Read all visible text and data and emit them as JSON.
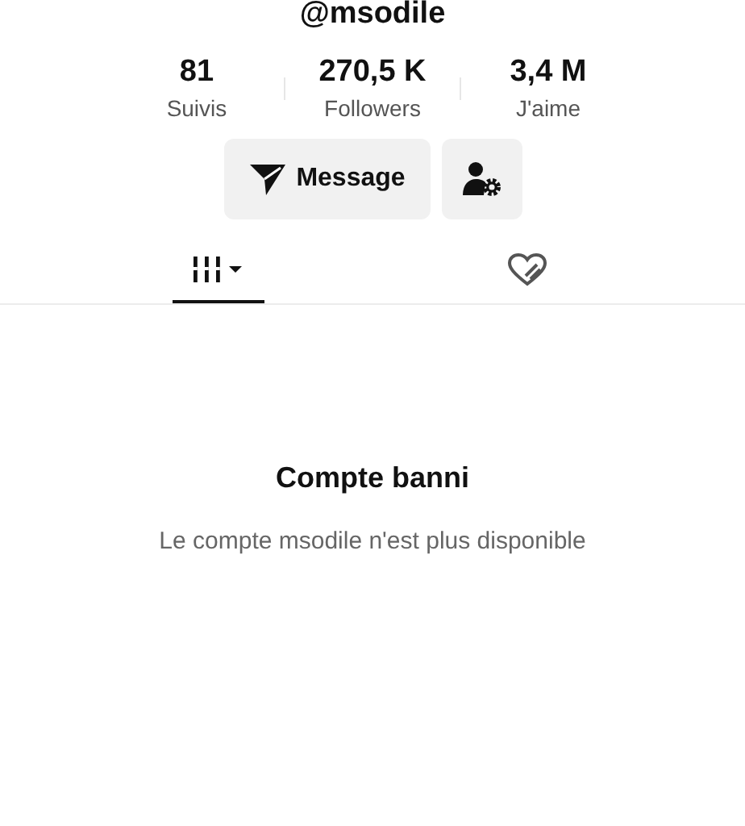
{
  "profile": {
    "username": "@msodile"
  },
  "stats": [
    {
      "value": "81",
      "label": "Suivis"
    },
    {
      "value": "270,5 K",
      "label": "Followers"
    },
    {
      "value": "3,4 M",
      "label": "J'aime"
    }
  ],
  "actions": {
    "message_label": "Message"
  },
  "tabs": [
    {
      "kind": "videos",
      "selected": true
    },
    {
      "kind": "liked",
      "selected": false
    }
  ],
  "notice": {
    "title": "Compte banni",
    "message": "Le compte msodile n'est plus disponible"
  }
}
